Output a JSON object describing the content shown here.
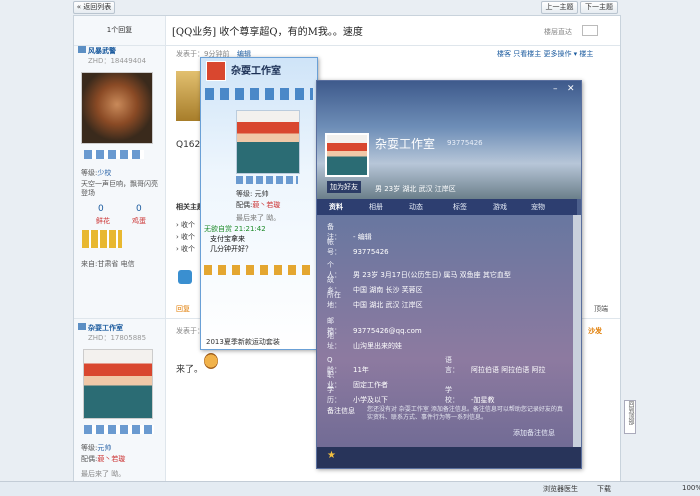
{
  "nav": {
    "back_label": "« 返回列表",
    "prev_label": "上一主题",
    "next_label": "下一主题"
  },
  "thread": {
    "reply_count": "1个回复",
    "title": "[QQ业务] 收个尊享超Q，有的M我。。速度",
    "view_mode_label": "楼层直达",
    "post_actions": "楼客  只看楼主  更多操作 ▾  楼主",
    "post_by": "发表于：9分钟前",
    "edit_label": "编辑",
    "body_partial": "Q1621",
    "related_label": "相关主题",
    "related_items": [
      "› 收个",
      "› 收个",
      "› 收个"
    ],
    "reply_label": "回复",
    "report_label": "顶端",
    "second_floor_label": "沙发",
    "second_post_by": "发表于：",
    "second_body": "来了。"
  },
  "user1": {
    "name": "风暴武警",
    "zid": "ZHD：18449404",
    "level_label": "等级:",
    "level": "少校",
    "sig": "天空一声巨响，飘哥闪亮登场",
    "stats": [
      {
        "count": "0",
        "label": "鲜花"
      },
      {
        "count": "0",
        "label": "鸡蛋"
      }
    ],
    "from": "来自:甘肃省 电信"
  },
  "user2": {
    "name": "杂耍工作室",
    "zid": "ZHD：17805885",
    "level_label": "等级:",
    "level": "元帅",
    "config_label": "配偶:",
    "config": "藐丶若璇",
    "status": "最后来了 呦。"
  },
  "chat": {
    "title": "杂耍工作室",
    "user_title": "等级: 元帅",
    "user_config_label": "配偶:",
    "user_config": "藐丶若璇",
    "user_status": "最后来了 呦。",
    "msg_sender": "无欲自赏",
    "msg_time": "21:21:42",
    "messages": [
      "支付宝拿来",
      "几分钟开好？"
    ],
    "ad": "2013夏季新款运动套装"
  },
  "profile": {
    "name": "杂耍工作室",
    "account_suffix": "93775426",
    "add_friend": "加为好友",
    "basic": "男  23岁  湖北 武汉 江岸区",
    "tabs": [
      "资料",
      "相册",
      "动态",
      "标签",
      "游戏",
      "宠物"
    ],
    "fields": [
      {
        "k": "备　注：",
        "v": "- 编辑"
      },
      {
        "k": "帐　号：",
        "v": "93775426"
      },
      {
        "k": "个　人：",
        "v": "男  23岁  3月17日(公历生日)  属马  双鱼座  其它血型"
      },
      {
        "k": "故　乡：",
        "v": "中国 湖南 长沙 芙蓉区"
      },
      {
        "k": "所在地：",
        "v": "中国 湖北 武汉 江岸区"
      },
      {
        "k": "邮　箱：",
        "v": "93775426@qq.com"
      },
      {
        "k": "地　址：",
        "v": "山沟里出来的娃"
      },
      {
        "k": "Q　龄：",
        "v": "11年"
      },
      {
        "k": "职　业：",
        "v": "固定工作者"
      },
      {
        "k": "学　历：",
        "v": "小学及以下"
      }
    ],
    "lang_label": "语　言：",
    "lang_value": "阿拉伯语 阿拉伯语 阿拉",
    "school_label": "学　校：",
    "school_value": "-加星教",
    "note_label": "备注信息",
    "note_text": "您还没有对 杂耍工作室 添加备注信息。备注信息可以帮助您记录好友的真实资料、联系方式、事件行为等一系列信息。",
    "note_add": "添加备注信息"
  },
  "taskbar": {
    "security": "浏览器医生",
    "download": "下载",
    "zoom": "100%"
  },
  "side_tab": "回到顶部",
  "colors": {
    "accent": "#1a5a9e",
    "qq_dark": "#2d3e70",
    "orange": "#e07b00"
  }
}
